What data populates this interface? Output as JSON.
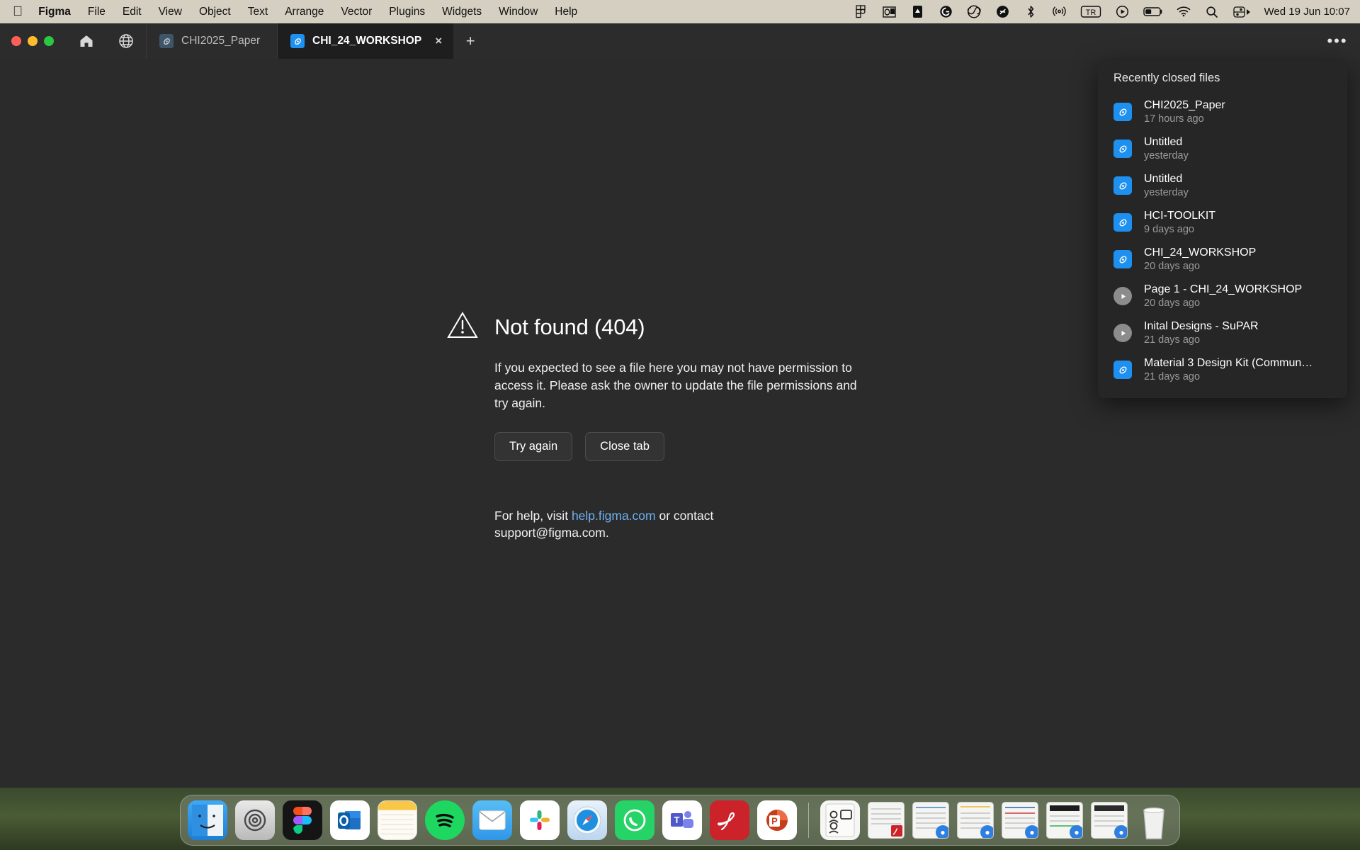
{
  "menubar": {
    "apple_icon": "apple-logo-icon",
    "items": [
      {
        "label": "Figma",
        "bold": true
      },
      {
        "label": "File",
        "bold": false
      },
      {
        "label": "Edit",
        "bold": false
      },
      {
        "label": "View",
        "bold": false
      },
      {
        "label": "Object",
        "bold": false
      },
      {
        "label": "Text",
        "bold": false
      },
      {
        "label": "Arrange",
        "bold": false
      },
      {
        "label": "Vector",
        "bold": false
      },
      {
        "label": "Plugins",
        "bold": false
      },
      {
        "label": "Widgets",
        "bold": false
      },
      {
        "label": "Window",
        "bold": false
      },
      {
        "label": "Help",
        "bold": false
      }
    ],
    "status_icons": [
      "figma-menu-icon",
      "outlook-menu-icon",
      "onedrive-menu-icon",
      "grammarly-menu-icon",
      "creative-cloud-menu-icon",
      "shazam-menu-icon",
      "bluetooth-icon",
      "airdrop-icon",
      "text-replacement-tr-icon",
      "now-playing-icon",
      "battery-icon",
      "wifi-icon",
      "spotlight-search-icon",
      "control-center-icon"
    ],
    "clock": "Wed 19 Jun 10:07"
  },
  "tabbar": {
    "home_icon": "home-icon",
    "browse_icon": "globe-icon",
    "new_tab_label": "+",
    "more_label": "•••",
    "tabs": [
      {
        "label": "CHI2025_Paper",
        "active": false,
        "closable": false
      },
      {
        "label": "CHI_24_WORKSHOP",
        "active": true,
        "closable": true,
        "close_label": "×"
      }
    ]
  },
  "error": {
    "warning_icon": "warning-triangle-icon",
    "title": "Not found (404)",
    "description": "If you expected to see a file here you may not have permission to access it. Please ask the owner to update the file permissions and try again.",
    "buttons": [
      {
        "label": "Try again",
        "name": "try-again-button"
      },
      {
        "label": "Close tab",
        "name": "close-tab-button"
      }
    ],
    "help_prefix": "For help, visit ",
    "help_link": "help.figma.com",
    "help_middle": " or contact ",
    "help_email": "support@figma.com."
  },
  "recent_panel": {
    "title": "Recently closed files",
    "items": [
      {
        "name": "CHI2025_Paper",
        "time": "17 hours ago",
        "icon": "figma-file-icon"
      },
      {
        "name": "Untitled",
        "time": "yesterday",
        "icon": "figma-file-icon"
      },
      {
        "name": "Untitled",
        "time": "yesterday",
        "icon": "figma-file-icon"
      },
      {
        "name": "HCI-TOOLKIT",
        "time": "9 days ago",
        "icon": "figma-file-icon"
      },
      {
        "name": "CHI_24_WORKSHOP",
        "time": "20 days ago",
        "icon": "figma-file-icon"
      },
      {
        "name": "Page 1 - CHI_24_WORKSHOP",
        "time": "20 days ago",
        "icon": "figma-prototype-icon"
      },
      {
        "name": "Inital Designs - SuPAR",
        "time": "21 days ago",
        "icon": "figma-prototype-icon"
      },
      {
        "name": "Material 3 Design Kit (Commun…",
        "time": "21 days ago",
        "icon": "figma-file-icon"
      }
    ]
  },
  "dock": {
    "apps": [
      {
        "name": "finder-dock-icon",
        "running": true
      },
      {
        "name": "system-settings-dock-icon",
        "running": true
      },
      {
        "name": "figma-dock-icon",
        "running": true
      },
      {
        "name": "outlook-dock-icon",
        "running": true
      },
      {
        "name": "notes-dock-icon",
        "running": false
      },
      {
        "name": "spotify-dock-icon",
        "running": true
      },
      {
        "name": "mail-dock-icon",
        "running": true
      },
      {
        "name": "slack-dock-icon",
        "running": true
      },
      {
        "name": "safari-dock-icon",
        "running": true
      },
      {
        "name": "whatsapp-dock-icon",
        "running": true
      },
      {
        "name": "microsoft-teams-dock-icon",
        "running": true
      },
      {
        "name": "adobe-acrobat-dock-icon",
        "running": true
      },
      {
        "name": "powerpoint-dock-icon",
        "running": false
      }
    ],
    "minimized_count": 7,
    "trash_icon": "trash-dock-icon"
  },
  "colors": {
    "menubar_bg": "#d5cfc2",
    "tabbar_bg": "#2c2c2c",
    "canvas_bg": "#2b2b2b",
    "panel_bg": "#262626",
    "figma_blue": "#1e90f0",
    "link_blue": "#6fb0f0"
  }
}
